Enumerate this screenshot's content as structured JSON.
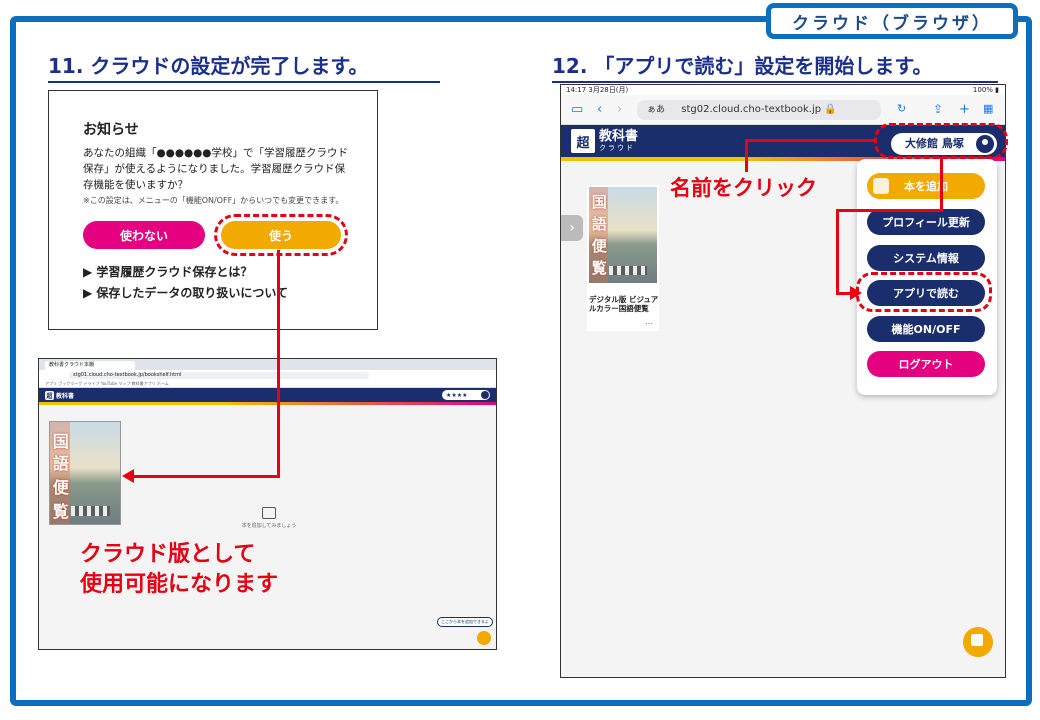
{
  "tag": "クラウド（ブラウザ）",
  "steps": {
    "s11": "11.  クラウドの設定が完了します。",
    "s12": "12. 「アプリで読む」設定を開始します。"
  },
  "dialog": {
    "title": "お知らせ",
    "body": "あなたの組織「●●●●●●学校」で「学習履歴クラウド保存」が使えるようになりました。学習履歴クラウド保存機能を使いますか？",
    "note": "※この設定は、メニューの「機能ON/OFF」からいつでも変更できます。",
    "decline_label": "使わない",
    "accept_label": "使う",
    "links": [
      "▶ 学習履歴クラウド保存とは？",
      "▶ 保存したデータの取り扱いについて"
    ]
  },
  "desktop": {
    "tab_title": "教科書クラウド本棚",
    "url": "stg01.cloud.cho-textbook.jp/bookshelf.html",
    "bookmarks": "アプリ  ブックマーク  ドライブ  YouTube  マップ  教科書アプリ  ホーム",
    "logo_main": "教科書",
    "logo_sub": "クラウド",
    "user_stars": "★★★★",
    "empty_text": "本を追加してみましょう",
    "hint": "ここから本を追加できるよ",
    "caption_lines": [
      "クラウド版として",
      "使用可能になります"
    ]
  },
  "book": {
    "kanji": [
      "国",
      "語",
      "便",
      "覧"
    ]
  },
  "tablet": {
    "status_time": "14:17  3月28日(月)",
    "status_right": "100% ▮",
    "aa": "ぁあ",
    "url": "stg02.cloud.cho-textbook.jp 🔒",
    "logo_main": "教科書",
    "logo_sub": "クラウド",
    "user_name": "大修館 鳥塚",
    "book_title": "デジタル版 ビジュアルカラー国語便覧",
    "more": "…",
    "name_caption": "名前をクリック",
    "menu": {
      "add": "本を追加",
      "profile": "プロフィール更新",
      "system": "システム情報",
      "app": "アプリで読む",
      "func": "機能ON/OFF",
      "logout": "ログアウト"
    }
  }
}
